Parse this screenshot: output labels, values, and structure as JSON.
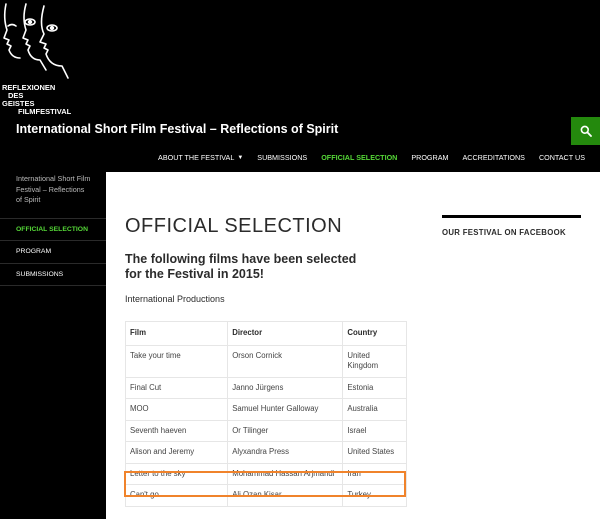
{
  "logo": {
    "lines": [
      "REFLEXIONEN",
      "DES",
      "GEISTES",
      "FILMFESTIVAL"
    ]
  },
  "site_title": "International Short Film Festival – Reflections of Spirit",
  "search": {
    "icon": "search-icon",
    "color": "#24890d"
  },
  "nav": {
    "items": [
      {
        "label": "About the Festival",
        "has_dropdown": true
      },
      {
        "label": "Submissions"
      },
      {
        "label": "Official Selection",
        "active": true
      },
      {
        "label": "Program"
      },
      {
        "label": "Accreditations"
      },
      {
        "label": "Contact us"
      }
    ],
    "active_color": "#55d737"
  },
  "sidebar": {
    "intro": "International Short Film Festival – Reflections of Spirit",
    "items": [
      {
        "label": "Official Selection",
        "active": true
      },
      {
        "label": "Program"
      },
      {
        "label": "Submissions"
      }
    ]
  },
  "main": {
    "title": "OFFICIAL SELECTION",
    "lead": "The following films have been selected for the Festival in 2015!",
    "section": "International Productions",
    "table": {
      "headers": [
        "Film",
        "Director",
        "Country"
      ],
      "rows": [
        [
          "Take your time",
          "Orson Cornick",
          "United Kingdom"
        ],
        [
          "Final Cut",
          "Janno Jürgens",
          "Estonia"
        ],
        [
          "MOO",
          "Samuel Hunter Galloway",
          "Australia"
        ],
        [
          "Seventh haeven",
          "Or Tilinger",
          "Israel"
        ],
        [
          "Alison and Jeremy",
          "Alyxandra Press",
          "United States"
        ],
        [
          "Letter to the sky",
          "Mohammad Hassan Arjmandi",
          "Iran"
        ],
        [
          "Can't go",
          "Ali Ozan Kisar",
          "Turkey"
        ]
      ],
      "highlighted_row": 5,
      "highlight_color": "#f0832b"
    }
  },
  "widget": {
    "title": "Our Festival on Facebook"
  }
}
